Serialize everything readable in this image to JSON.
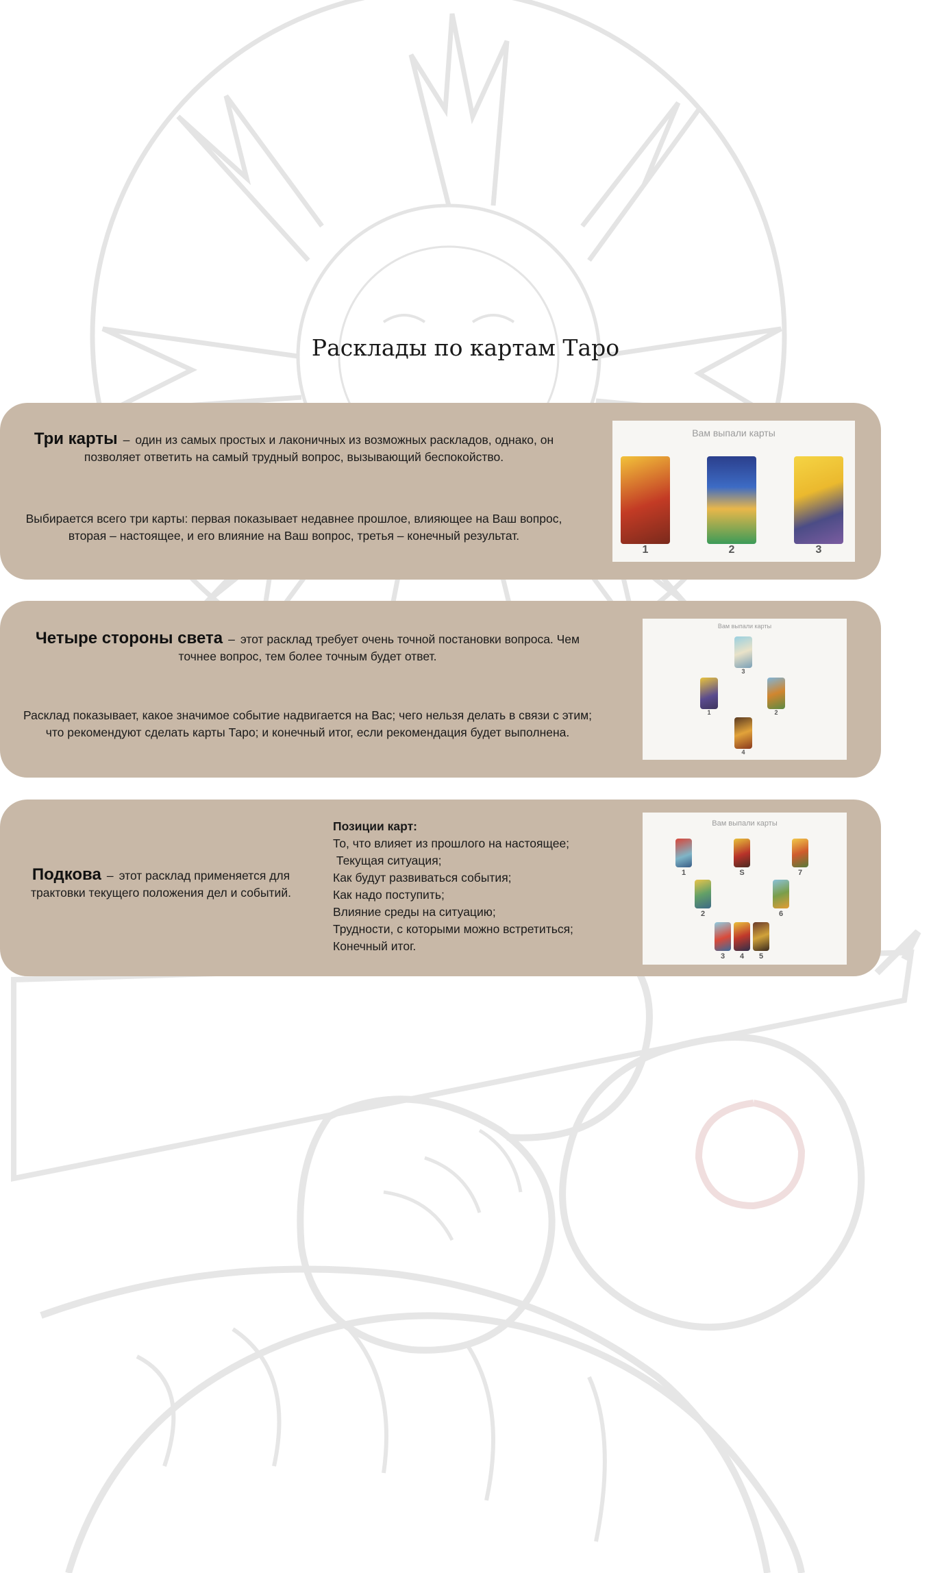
{
  "page": {
    "title": "Расклады по картам Таро"
  },
  "spreads": [
    {
      "name": "Три карты",
      "intro": "один из самых простых и лаконичных из возможных раскладов, однако, он позволяет ответить на самый трудный вопрос, вызывающий беспокойство.",
      "detail": "Выбирается всего три карты: первая показывает недавнее прошлое, влияющее на Ваш вопрос, вторая – настоящее, и его влияние на Ваш вопрос, третья – конечный результат.",
      "image_caption": "Вам выпали карты",
      "card_numbers": [
        "1",
        "2",
        "3"
      ]
    },
    {
      "name": "Четыре стороны света",
      "intro": "этот расклад требует очень точной постановки вопроса. Чем точнее вопрос, тем более точным будет ответ.",
      "detail": "Расклад показывает, какое значимое событие надвигается на Вас; чего нельзя делать в связи с этим; что рекомендуют сделать карты Таро; и конечный итог, если рекомендация будет выполнена.",
      "image_caption": "Вам выпали карты",
      "card_numbers": [
        "3",
        "1",
        "2",
        "4"
      ]
    },
    {
      "name": "Подкова",
      "intro": "этот расклад применяется для трактовки текущего положения дел и событий.",
      "positions_heading": "Позиции карт:",
      "positions": [
        "То, что влияет из прошлого на настоящее;",
        " Текущая ситуация;",
        "Как будут развиваться события;",
        "Как надо поступить;",
        "Влияние среды на ситуацию;",
        "Трудности, с которыми можно встретиться;",
        "Конечный итог."
      ],
      "image_caption": "Вам выпали карты",
      "card_numbers": [
        "1",
        "S",
        "7",
        "2",
        "6",
        "3",
        "4",
        "5"
      ]
    }
  ],
  "colors": {
    "panel": "#c8b8a7",
    "screenshot_bg": "#f7f6f3",
    "page_bg": "#ffffff"
  },
  "icons": {
    "background_top": "sun-engraving-icon",
    "background_bottom": "knight-engraving-icon"
  }
}
